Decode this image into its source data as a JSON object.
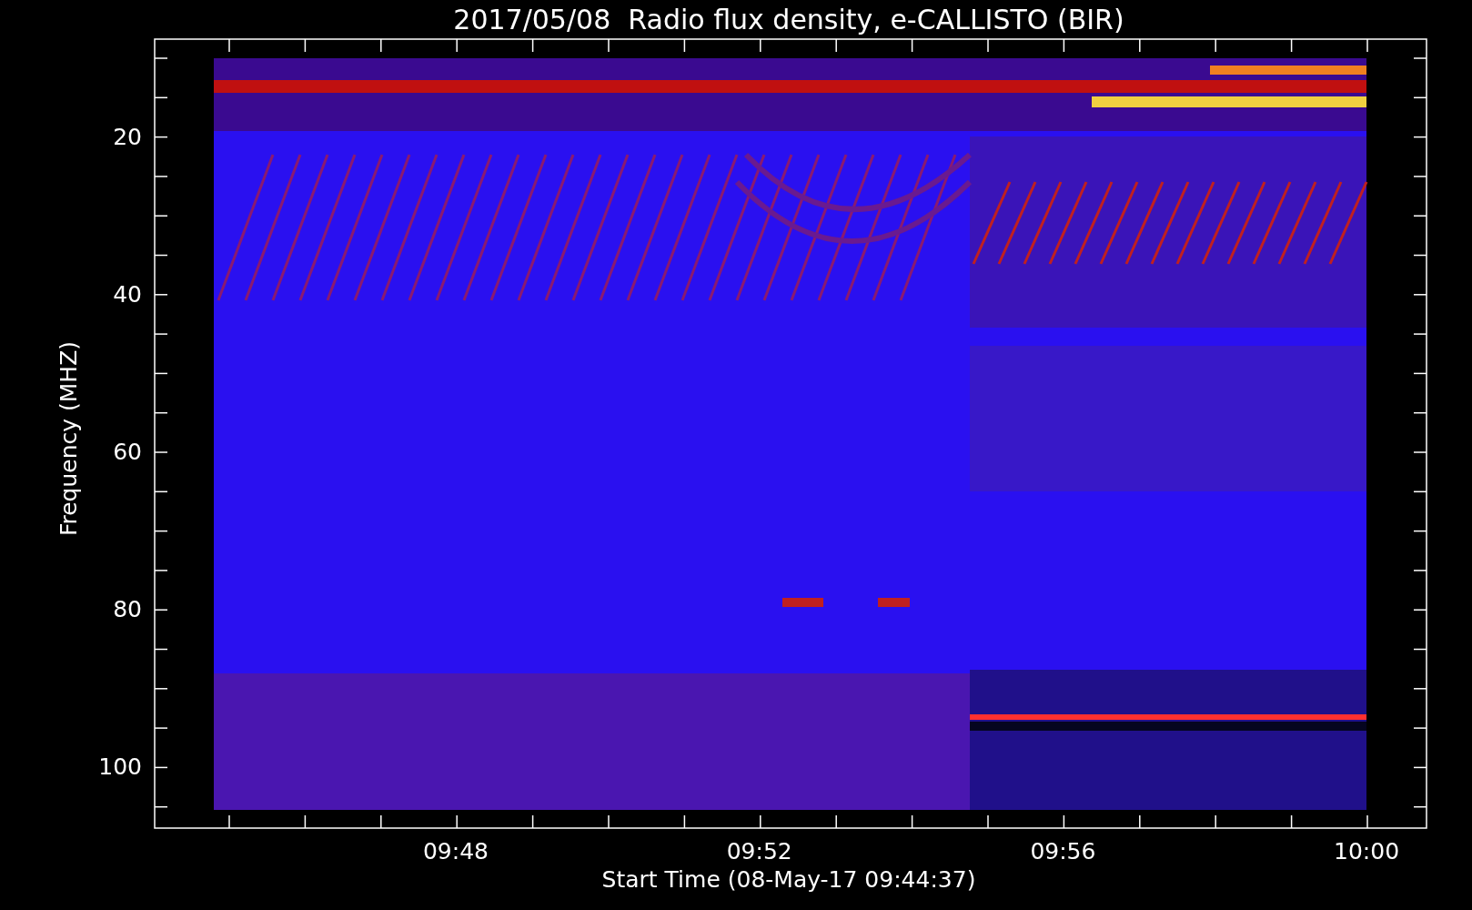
{
  "title": "2017/05/08  Radio flux density, e-CALLISTO (BIR)",
  "y_axis": {
    "label": "Frequency (MHZ)",
    "ticks": [
      "20",
      "40",
      "60",
      "80",
      "100"
    ]
  },
  "x_axis": {
    "label": "Start Time (08-May-17 09:44:37)",
    "ticks": [
      "09:48",
      "09:52",
      "09:56",
      "10:00"
    ]
  }
}
